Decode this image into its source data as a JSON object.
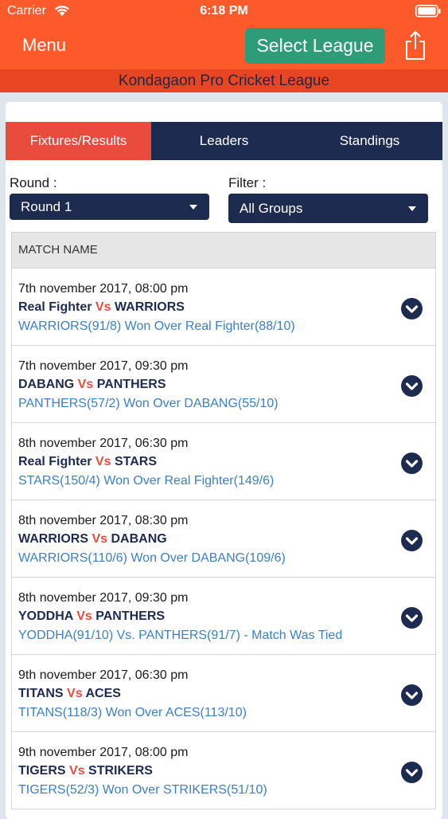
{
  "status_bar": {
    "carrier": "Carrier",
    "time": "6:18 PM"
  },
  "header": {
    "menu_label": "Menu",
    "select_league_label": "Select League",
    "league_name": "Kondagaon Pro Cricket League"
  },
  "tabs": [
    {
      "label": "Fixtures/Results",
      "active": true
    },
    {
      "label": "Leaders",
      "active": false
    },
    {
      "label": "Standings",
      "active": false
    }
  ],
  "filters": {
    "round_label": "Round :",
    "round_value": "Round 1",
    "filter_label": "Filter :",
    "filter_value": "All Groups"
  },
  "table": {
    "header": "MATCH NAME",
    "vs_text": "Vs",
    "matches": [
      {
        "date": "7th november 2017, 08:00 pm",
        "team1": "Real Fighter",
        "team2": "WARRIORS",
        "result": "WARRIORS(91/8) Won Over Real Fighter(88/10)"
      },
      {
        "date": "7th november 2017, 09:30 pm",
        "team1": "DABANG",
        "team2": "PANTHERS",
        "result": "PANTHERS(57/2) Won Over DABANG(55/10)"
      },
      {
        "date": "8th november 2017, 06:30 pm",
        "team1": "Real Fighter",
        "team2": "STARS",
        "result": "STARS(150/4) Won Over Real Fighter(149/6)"
      },
      {
        "date": "8th november 2017, 08:30 pm",
        "team1": "WARRIORS",
        "team2": "DABANG",
        "result": "WARRIORS(110/6) Won Over DABANG(109/6)"
      },
      {
        "date": "8th november 2017, 09:30 pm",
        "team1": "YODDHA",
        "team2": "PANTHERS",
        "result": "YODDHA(91/10) Vs. PANTHERS(91/7) - Match Was Tied"
      },
      {
        "date": "9th november 2017, 06:30 pm",
        "team1": "TITANS",
        "team2": "ACES",
        "result": "TITANS(118/3) Won Over ACES(113/10)"
      },
      {
        "date": "9th november 2017, 08:00 pm",
        "team1": "TIGERS",
        "team2": "STRIKERS",
        "result": "TIGERS(52/3) Won Over STRIKERS(51/10)"
      }
    ]
  },
  "icons": {
    "wifi": "wifi-icon",
    "battery": "battery-icon",
    "share": "share-icon",
    "dropdown": "chevron-down-icon",
    "expand": "chevron-circle-down-icon"
  },
  "colors": {
    "header_orange": "#fc5a2a",
    "league_strip": "#e84522",
    "select_league_green": "#2e9c76",
    "navy": "#1e2b50",
    "active_tab_red": "#e94b3c",
    "result_blue": "#3b7fc4"
  }
}
